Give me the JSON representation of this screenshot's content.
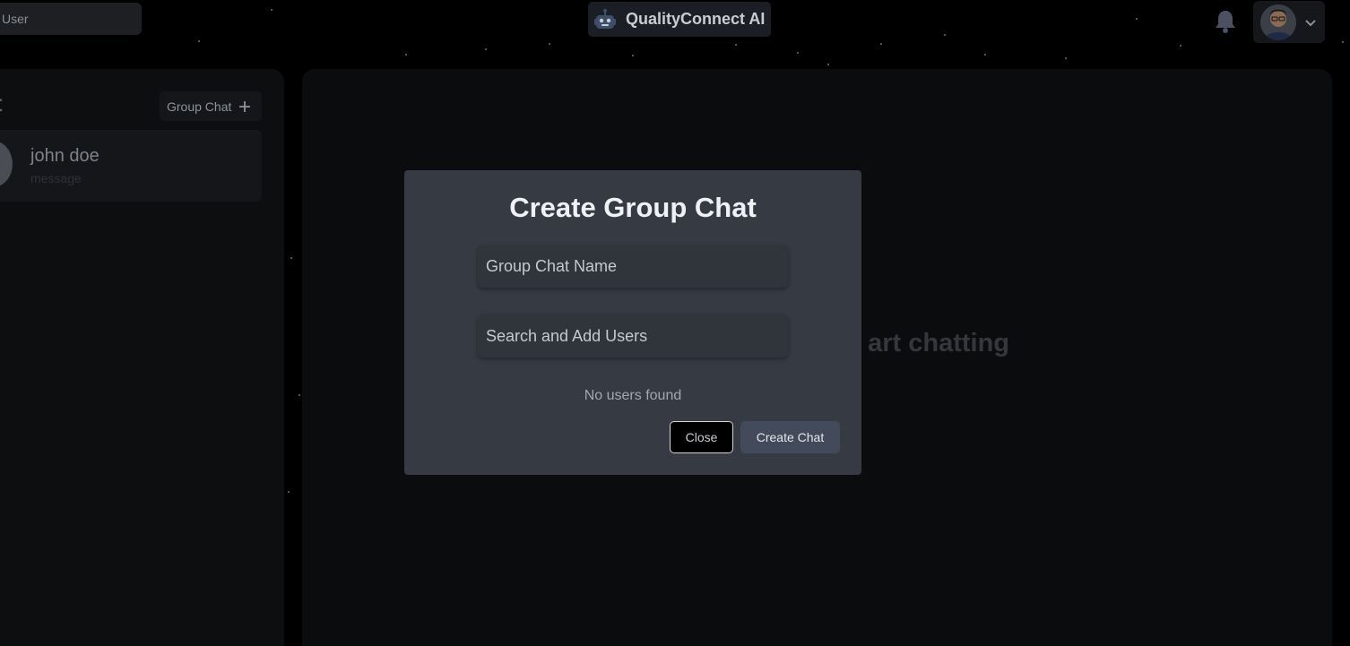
{
  "header": {
    "search_placeholder": "User",
    "brand_name": "QualityConnect AI",
    "brand_icon": "robot-icon",
    "notification_icon": "bell-icon",
    "profile_menu_icon": "chevron-down-icon"
  },
  "sidebar": {
    "title": "t",
    "group_chat_button_label": "Group Chat",
    "group_chat_button_icon": "plus-icon",
    "chats": [
      {
        "name": "john doe",
        "preview": "message"
      }
    ]
  },
  "main": {
    "empty_state_text": "art chatting"
  },
  "modal": {
    "title": "Create Group Chat",
    "group_name_placeholder": "Group Chat Name",
    "group_name_value": "",
    "user_search_placeholder": "Search and Add Users",
    "user_search_value": "",
    "no_users_text": "No users found",
    "close_label": "Close",
    "create_label": "Create Chat"
  },
  "colors": {
    "background": "#000000",
    "modal_background": "#353a43",
    "create_button": "#434a59",
    "brand_text": "#c9ccd3"
  }
}
